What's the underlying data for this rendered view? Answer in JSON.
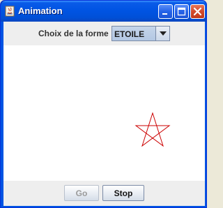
{
  "window": {
    "title": "Animation",
    "icons": [
      "java-app-icon",
      "minimize-icon",
      "maximize-icon",
      "close-icon"
    ],
    "colors": {
      "titlebar": "#0054e3",
      "close_button": "#d24a2c"
    }
  },
  "controls": {
    "shape_label": "Choix de la forme",
    "shape_selected": "ETOILE"
  },
  "canvas": {
    "shape": "star-icon",
    "stroke_color": "#cc0000"
  },
  "buttons": {
    "go_label": "Go",
    "stop_label": "Stop"
  }
}
